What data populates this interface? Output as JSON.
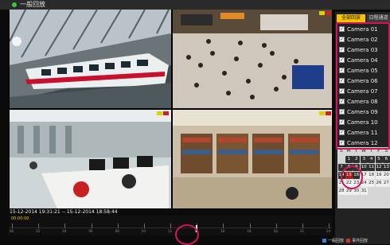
{
  "window": {
    "title": "一般回放"
  },
  "playback": {
    "timestamp": "15-12-2014 19:31:21 -- 15-12-2014 18:58:44",
    "time_start": "00:00:00",
    "timeline_labels": [
      "00",
      "02",
      "04",
      "06",
      "08",
      "10",
      "12",
      "14",
      "16",
      "18",
      "20",
      "22",
      "24"
    ]
  },
  "panel": {
    "tabs": [
      {
        "label": "全部回放"
      },
      {
        "label": "日程通道"
      }
    ],
    "cameras": [
      {
        "label": "Camera 01"
      },
      {
        "label": "Camera 02"
      },
      {
        "label": "Camera 03"
      },
      {
        "label": "Camera 04"
      },
      {
        "label": "Camera 05"
      },
      {
        "label": "Camera 06"
      },
      {
        "label": "Camera 07"
      },
      {
        "label": "Camera 08"
      },
      {
        "label": "Camera 09"
      },
      {
        "label": "Camera 10"
      },
      {
        "label": "Camera 11"
      },
      {
        "label": "Camera 12"
      }
    ],
    "checkbox_mark": "✓"
  },
  "calendar": {
    "weekdays": [
      "S",
      "M",
      "T",
      "W",
      "T",
      "F",
      "S"
    ],
    "days": [
      "1",
      "2",
      "3",
      "4",
      "5",
      "6",
      "7",
      "8",
      "9",
      "10",
      "11",
      "12",
      "13",
      "14",
      "15",
      "16",
      "17",
      "18",
      "19",
      "20",
      "21",
      "22",
      "23",
      "24",
      "25",
      "26",
      "27",
      "28",
      "29",
      "30",
      "31"
    ],
    "selected_day": "15",
    "recorded_days": [
      "1",
      "2",
      "3",
      "4",
      "5",
      "6",
      "7",
      "8",
      "9",
      "10",
      "11",
      "12",
      "13",
      "14",
      "15",
      "16"
    ]
  },
  "legend": {
    "items": [
      {
        "label": "一般回放",
        "color": "#3b7dd8"
      },
      {
        "label": "事件回放",
        "color": "#d0342c"
      }
    ]
  },
  "colors": {
    "accent": "#f5c400",
    "highlight": "#d4145a"
  }
}
